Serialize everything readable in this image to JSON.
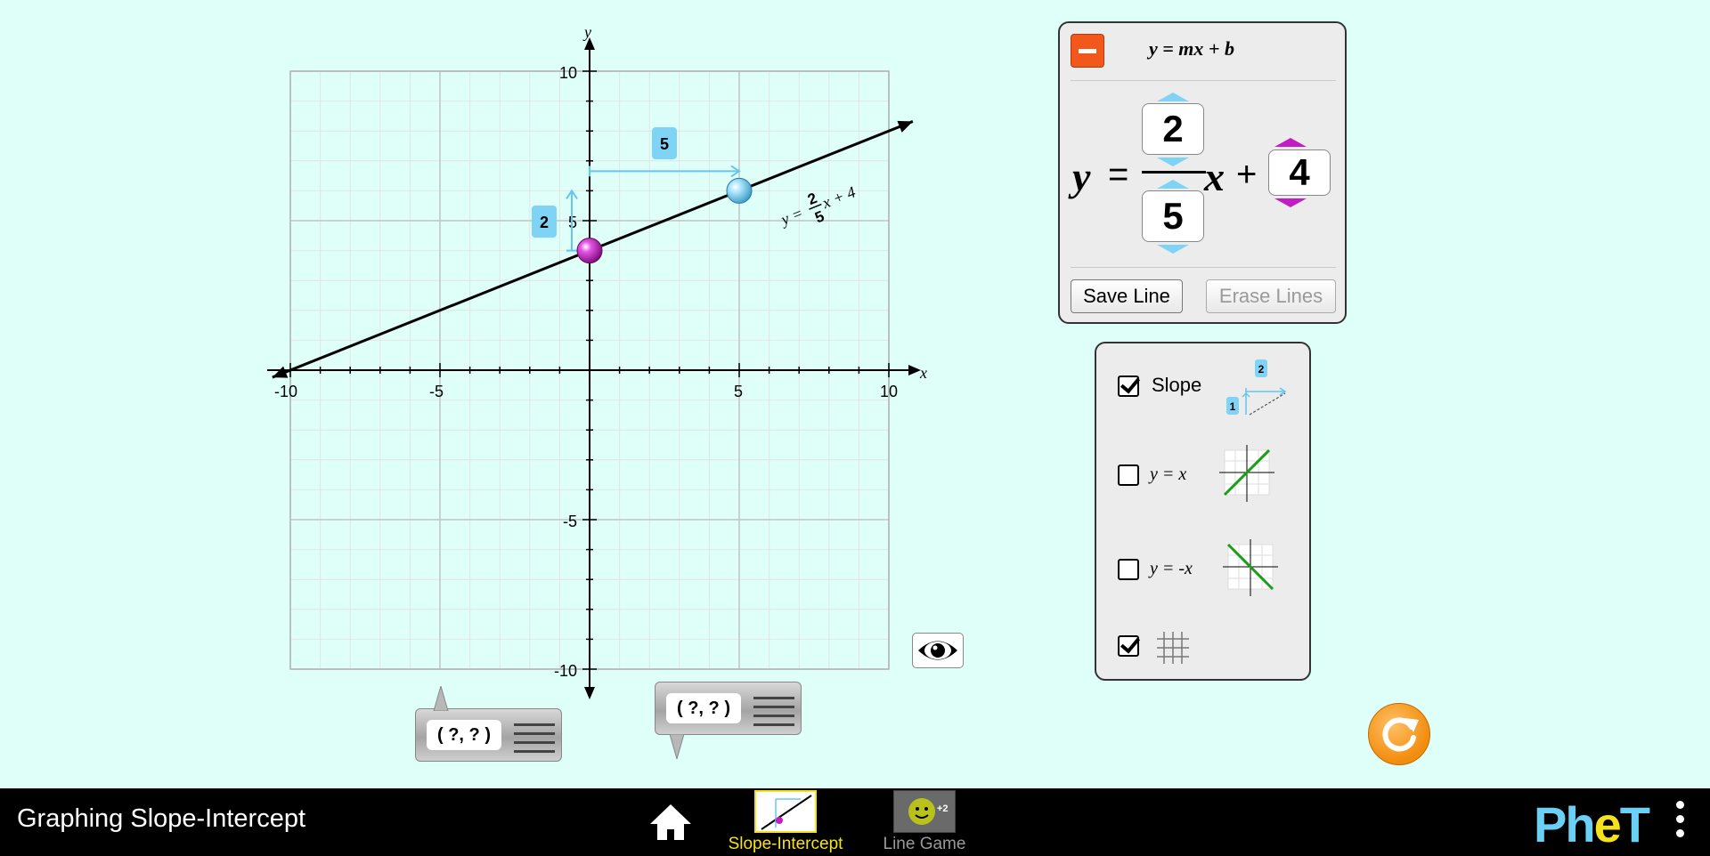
{
  "graph": {
    "x_axis_name": "x",
    "y_axis_name": "y",
    "x_ticks": [
      "-10",
      "-5",
      "5",
      "10"
    ],
    "y_ticks": [
      "10",
      "5",
      "-5",
      "-10"
    ],
    "line_label": {
      "lhs": "y =",
      "num": "2",
      "den": "5",
      "rhs": "x + 4"
    },
    "rise_label": "2",
    "run_label": "5"
  },
  "chart_data": {
    "type": "line",
    "x_range": [
      -10,
      10
    ],
    "y_range": [
      -10,
      10
    ],
    "grid": true,
    "slope_rise": 2,
    "slope_run": 5,
    "intercept": 4,
    "points": [
      {
        "x": 0,
        "y": 4
      },
      {
        "x": 5,
        "y": 6
      }
    ]
  },
  "equation_panel": {
    "title": "y = mx + b",
    "y_var": "y",
    "equals": "=",
    "x_var": "x",
    "plus": "+",
    "rise": "2",
    "run": "5",
    "intercept": "4",
    "save_label": "Save Line",
    "erase_label": "Erase Lines"
  },
  "options": {
    "slope_label": "Slope",
    "slope_checked": true,
    "yx_label": "y = x",
    "yx_checked": false,
    "ynegx_label": "y = -x",
    "ynegx_checked": false,
    "grid_checked": true,
    "icon_rise": "2",
    "icon_run": "1"
  },
  "point_tools": {
    "tool1": "( ?, ? )",
    "tool2": "( ?, ? )"
  },
  "navbar": {
    "title": "Graphing Slope-Intercept",
    "screen1": "Slope-Intercept",
    "screen2": "Line Game",
    "game_badge": "+2",
    "logo": "PhET",
    "accent": "#f5e11c"
  },
  "colors": {
    "background": "#dffff9",
    "rise_run": "#63c5f2",
    "intercept_point": "#c21cc2",
    "slope_point": "#7fd3f5",
    "reset": "#f28c0c"
  }
}
